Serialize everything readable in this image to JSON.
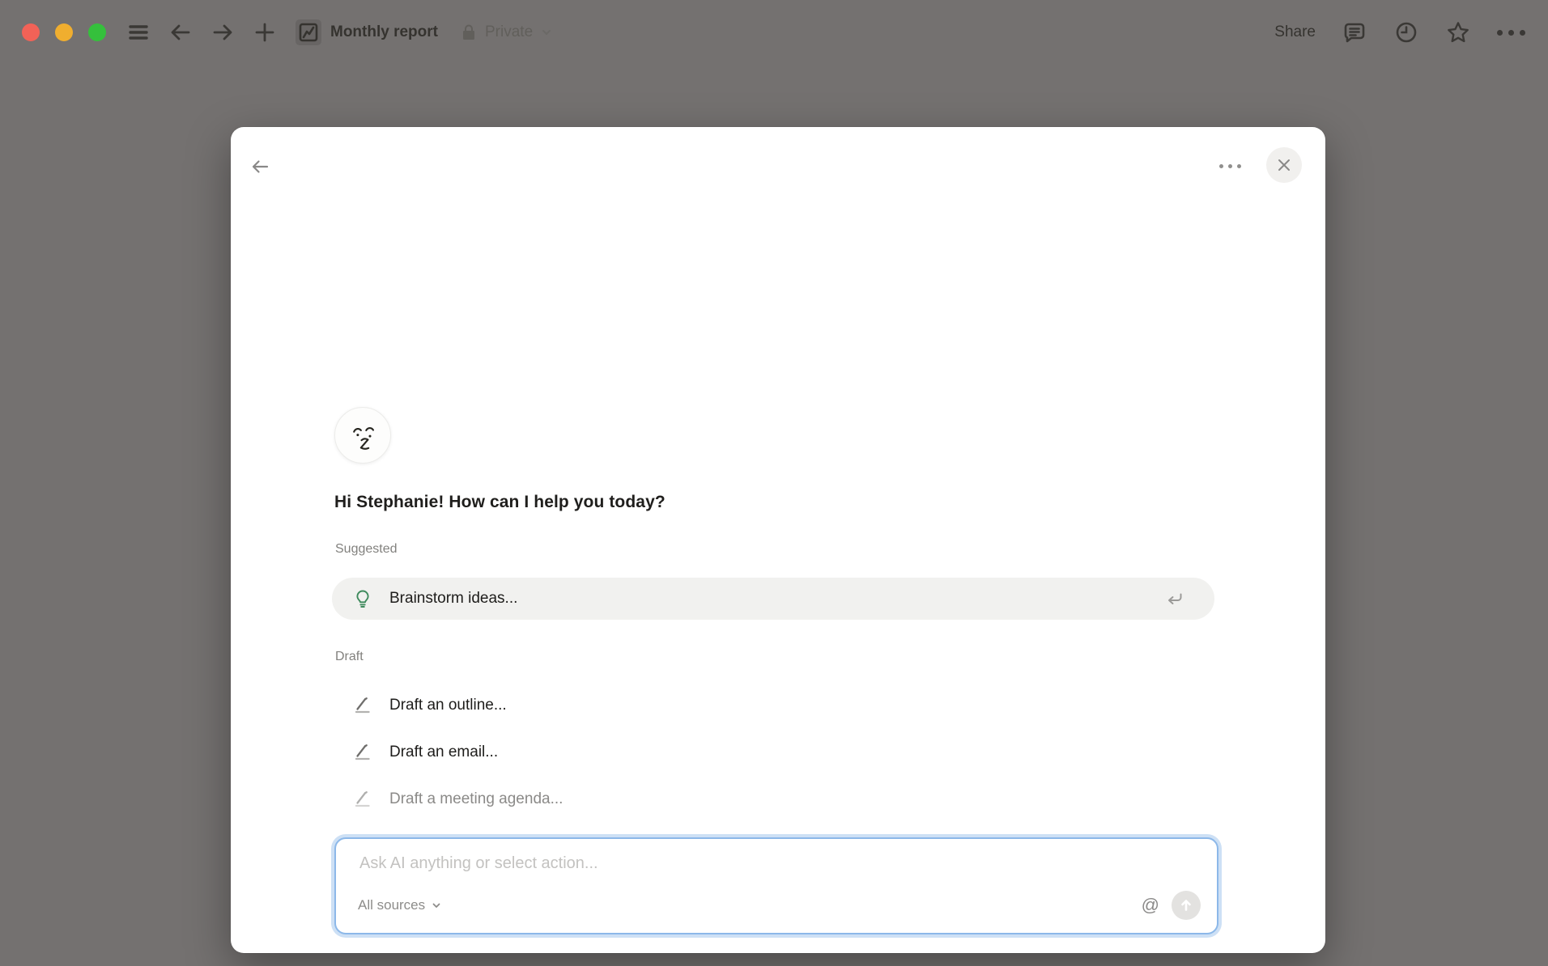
{
  "topbar": {
    "title": "Monthly report",
    "privacy_label": "Private",
    "share_label": "Share"
  },
  "modal": {
    "greeting": "Hi Stephanie! How can I help you today?",
    "suggested": {
      "label": "Suggested",
      "items": [
        {
          "label": "Brainstorm ideas...",
          "icon": "lightbulb-icon"
        }
      ]
    },
    "draft": {
      "label": "Draft",
      "items": [
        {
          "label": "Draft an outline...",
          "icon": "pen-line-icon"
        },
        {
          "label": "Draft an email...",
          "icon": "pen-line-icon"
        },
        {
          "label": "Draft a meeting agenda...",
          "icon": "pen-line-icon"
        }
      ]
    },
    "input": {
      "placeholder": "Ask AI anything or select action...",
      "scope_label": "All sources",
      "mention_symbol": "@"
    }
  },
  "colors": {
    "overlay_bg": "#747170",
    "accent_blue": "#2383e2",
    "focus_ring": "#cde0f5",
    "bulb_green": "#3e8a5c",
    "traffic_red": "#f26257",
    "traffic_yellow": "#f0ae2f",
    "traffic_green": "#35c03c"
  }
}
